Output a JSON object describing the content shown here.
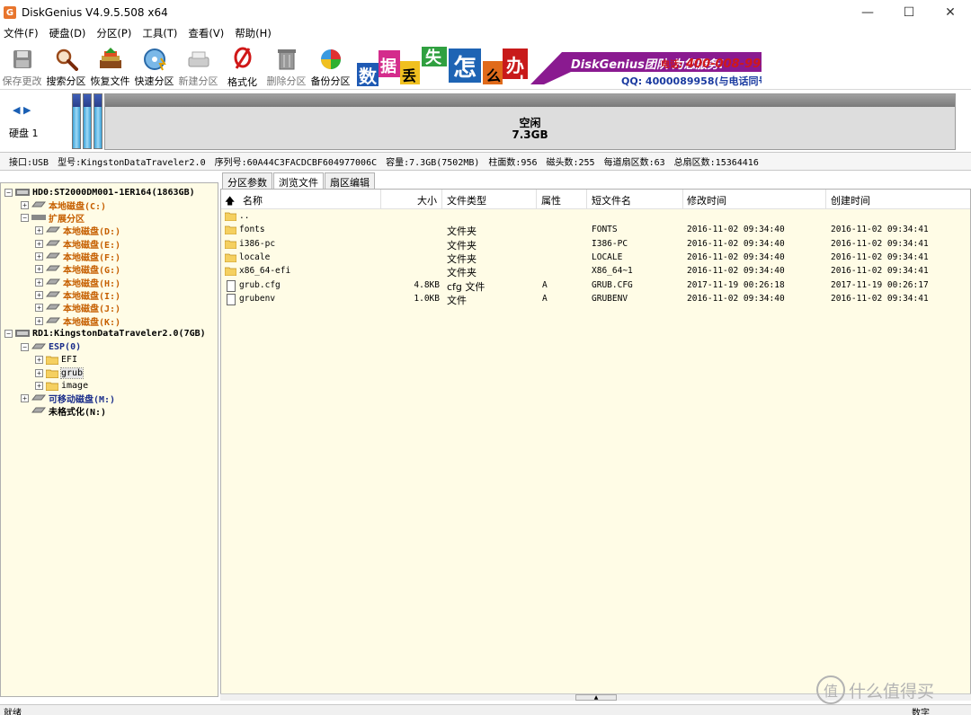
{
  "window": {
    "title": "DiskGenius V4.9.5.508 x64",
    "app_icon_glyph": "G",
    "controls": [
      "—",
      "☐",
      "✕"
    ]
  },
  "menu": [
    "文件(F)",
    "硬盘(D)",
    "分区(P)",
    "工具(T)",
    "查看(V)",
    "帮助(H)"
  ],
  "toolbar": {
    "save_changes": "保存更改",
    "search_partition": "搜索分区",
    "recover_files": "恢复文件",
    "quick_partition": "快速分区",
    "new_partition": "新建分区",
    "format": "格式化",
    "delete_partition": "删除分区",
    "backup_partition": "备份分区"
  },
  "banner": {
    "chars": [
      "数",
      "据",
      "丢",
      "失",
      "怎",
      "么",
      "办",
      "!"
    ],
    "team_text": "DiskGenius团队 为您服务!",
    "phone_label": "电话:",
    "phone": "400-008-9958",
    "qq": "QQ: 4000089958(与电话同号)"
  },
  "diskmap": {
    "label": "硬盘 1",
    "free_label": "空闲",
    "free_size": "7.3GB"
  },
  "diskinfo": {
    "interface": "接口:USB",
    "model": "型号:KingstonDataTraveler2.0",
    "serial": "序列号:60A44C3FACDCBF604977006C",
    "capacity": "容量:7.3GB(7502MB)",
    "cylinders": "柱面数:956",
    "heads": "磁头数:255",
    "sectors_per_track": "每道扇区数:63",
    "total_sectors": "总扇区数:15364416"
  },
  "tree": {
    "hd0": "HD0:ST2000DM001-1ER164(1863GB)",
    "local_c": "本地磁盘(C:)",
    "extended": "扩展分区",
    "locals": [
      "本地磁盘(D:)",
      "本地磁盘(E:)",
      "本地磁盘(F:)",
      "本地磁盘(G:)",
      "本地磁盘(H:)",
      "本地磁盘(I:)",
      "本地磁盘(J:)",
      "本地磁盘(K:)"
    ],
    "rd1": "RD1:KingstonDataTraveler2.0(7GB)",
    "esp": "ESP(0)",
    "efi": "EFI",
    "grub": "grub",
    "image": "image",
    "removable": "可移动磁盘(M:)",
    "unformatted": "未格式化(N:)"
  },
  "tabs": [
    "分区参数",
    "浏览文件",
    "扇区编辑"
  ],
  "columns": {
    "name": "名称",
    "size": "大小",
    "type": "文件类型",
    "attr": "属性",
    "short": "短文件名",
    "modified": "修改时间",
    "created": "创建时间"
  },
  "files": [
    {
      "name": "..",
      "size": "",
      "type": "",
      "attr": "",
      "short": "",
      "modified": "",
      "created": "",
      "kind": "folder"
    },
    {
      "name": "fonts",
      "size": "",
      "type": "文件夹",
      "attr": "",
      "short": "FONTS",
      "modified": "2016-11-02 09:34:40",
      "created": "2016-11-02 09:34:41",
      "kind": "folder"
    },
    {
      "name": "i386-pc",
      "size": "",
      "type": "文件夹",
      "attr": "",
      "short": "I386-PC",
      "modified": "2016-11-02 09:34:40",
      "created": "2016-11-02 09:34:41",
      "kind": "folder"
    },
    {
      "name": "locale",
      "size": "",
      "type": "文件夹",
      "attr": "",
      "short": "LOCALE",
      "modified": "2016-11-02 09:34:40",
      "created": "2016-11-02 09:34:41",
      "kind": "folder"
    },
    {
      "name": "x86_64-efi",
      "size": "",
      "type": "文件夹",
      "attr": "",
      "short": "X86_64~1",
      "modified": "2016-11-02 09:34:40",
      "created": "2016-11-02 09:34:41",
      "kind": "folder"
    },
    {
      "name": "grub.cfg",
      "size": "4.8KB",
      "type": "cfg 文件",
      "attr": "A",
      "short": "GRUB.CFG",
      "modified": "2017-11-19 00:26:18",
      "created": "2017-11-19 00:26:17",
      "kind": "file"
    },
    {
      "name": "grubenv",
      "size": "1.0KB",
      "type": "文件",
      "attr": "A",
      "short": "GRUBENV",
      "modified": "2016-11-02 09:34:40",
      "created": "2016-11-02 09:34:41",
      "kind": "file"
    }
  ],
  "status": {
    "left": "就绪",
    "right": "数字"
  },
  "watermark": {
    "glyph": "值",
    "text": "什么值得买"
  },
  "colors": {
    "tree_bg": "#fffce6",
    "orange_text": "#c65f00",
    "blue_text": "#1a2d8a",
    "partition_blue": "#3aa2d8",
    "free_gray": "#dddddd"
  }
}
